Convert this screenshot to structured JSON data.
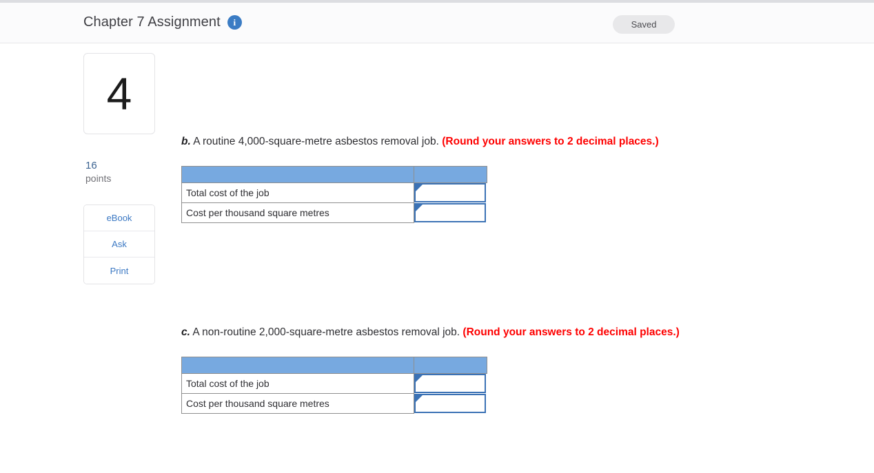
{
  "header": {
    "title": "Chapter 7 Assignment",
    "info_icon": "info-icon",
    "status_badge": "Saved"
  },
  "rail": {
    "question_number": "4",
    "points_value": "16",
    "points_label": "points",
    "tools": [
      {
        "label": "eBook"
      },
      {
        "label": "Ask"
      },
      {
        "label": "Print"
      }
    ]
  },
  "parts": [
    {
      "letter": "b.",
      "prompt": "A routine 4,000-square-metre asbestos removal job.",
      "round_note": "(Round your answers to 2 decimal places.)",
      "table": {
        "headers": [
          "",
          ""
        ],
        "rows": [
          {
            "label": "Total cost of the job",
            "value": "",
            "placeholder": ""
          },
          {
            "label": "Cost per thousand square metres",
            "value": "",
            "placeholder": ""
          }
        ]
      }
    },
    {
      "letter": "c.",
      "prompt": "A non-routine 2,000-square-metre asbestos removal job.",
      "round_note": "(Round your answers to 2 decimal places.)",
      "table": {
        "headers": [
          "",
          ""
        ],
        "rows": [
          {
            "label": "Total cost of the job",
            "value": "",
            "placeholder": ""
          },
          {
            "label": "Cost per thousand square metres",
            "value": "",
            "placeholder": ""
          }
        ]
      }
    }
  ],
  "colors": {
    "table_header_blue": "#77a9e0",
    "input_border_blue": "#3b72b5",
    "round_note_red": "#fe0000",
    "link_blue": "#3b78c3",
    "points_blue": "#3d6492",
    "badge_gray": "#e8e8ea"
  }
}
